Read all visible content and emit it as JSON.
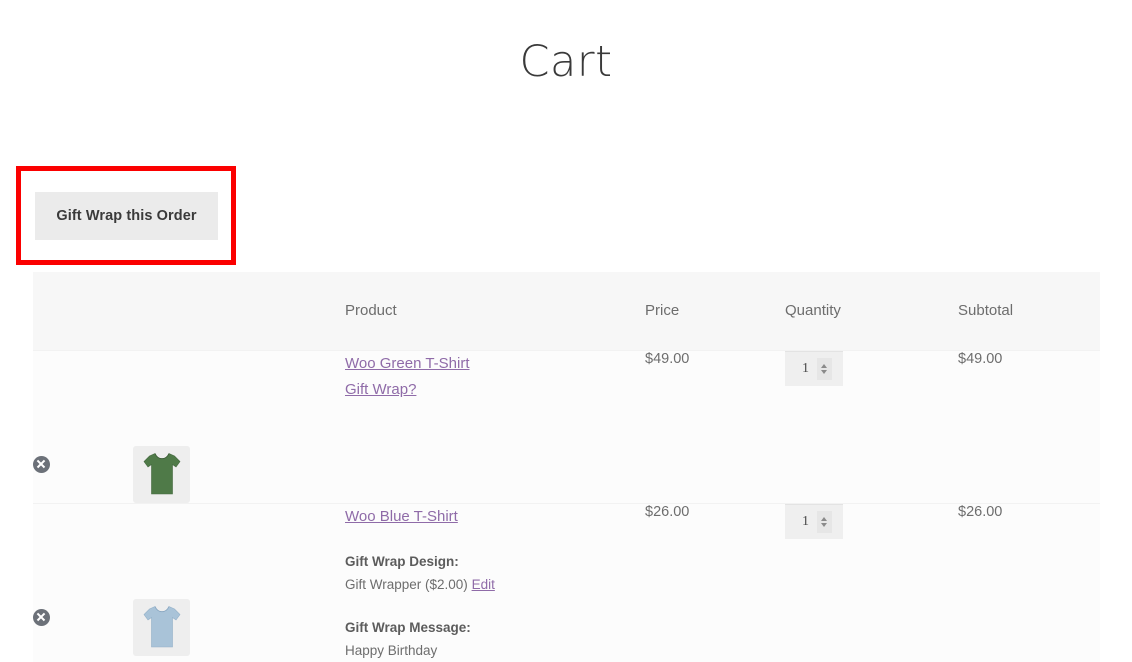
{
  "page": {
    "title": "Cart"
  },
  "toolbar": {
    "gift_wrap_button": "Gift Wrap this Order"
  },
  "cart_table": {
    "headers": {
      "remove": "",
      "thumbnail": "",
      "product": "Product",
      "price": "Price",
      "quantity": "Quantity",
      "subtotal": "Subtotal"
    },
    "rows": [
      {
        "remove_icon": "remove-circle-x-icon",
        "thumbnail_icon": "green-tshirt-thumbnail",
        "thumbnail_color": "#4f7a48",
        "product_name": "Woo Green T-Shirt",
        "gift_wrap_link": "Gift Wrap?",
        "price": "$49.00",
        "quantity": "1",
        "subtotal": "$49.00",
        "meta": []
      },
      {
        "remove_icon": "remove-circle-x-icon",
        "thumbnail_icon": "blue-tshirt-thumbnail",
        "thumbnail_color": "#a9c3d8",
        "product_name": "Woo Blue T-Shirt",
        "gift_wrap_link": "",
        "price": "$26.00",
        "quantity": "1",
        "subtotal": "$26.00",
        "meta": [
          {
            "label": "Gift Wrap Design:",
            "value": "Gift Wrapper ($2.00)",
            "edit_link": "Edit"
          },
          {
            "label": "Gift Wrap Message:",
            "value": "Happy Birthday",
            "edit_link": ""
          }
        ]
      }
    ]
  },
  "annotation": {
    "highlight_color": "#fb0000",
    "target": "gift-wrap-this-order-button"
  },
  "colors": {
    "link": "#8f6ba8",
    "header_bg": "#f7f7f7",
    "row_bg": "#fcfcfc",
    "button_bg": "#ebebeb",
    "text": "#6d6d6d"
  }
}
